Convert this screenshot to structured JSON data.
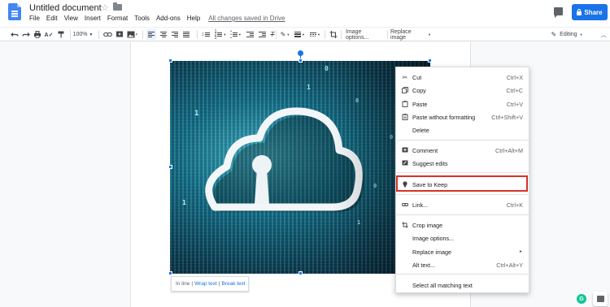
{
  "header": {
    "title": "Untitled document",
    "menus": [
      "File",
      "Edit",
      "View",
      "Insert",
      "Format",
      "Tools",
      "Add-ons",
      "Help"
    ],
    "save_status": "All changes saved in Drive",
    "share_label": "Share"
  },
  "toolbar": {
    "zoom": "100%",
    "image_options": "Image options...",
    "replace_image": "Replace image",
    "mode": "Editing"
  },
  "wrap_bar": {
    "inline": "In line",
    "wrap": "Wrap text",
    "break": "Break text",
    "separator": "|"
  },
  "context_menu": {
    "items": [
      {
        "label": "Cut",
        "shortcut": "Ctrl+X",
        "icon": "scissors-icon"
      },
      {
        "label": "Copy",
        "shortcut": "Ctrl+C",
        "icon": "copy-icon"
      },
      {
        "label": "Paste",
        "shortcut": "Ctrl+V",
        "icon": "paste-icon"
      },
      {
        "label": "Paste without formatting",
        "shortcut": "Ctrl+Shift+V",
        "icon": "paste-plain-icon"
      },
      {
        "label": "Delete",
        "shortcut": "",
        "icon": ""
      },
      {
        "label": "Comment",
        "shortcut": "Ctrl+Alt+M",
        "icon": "comment-icon"
      },
      {
        "label": "Suggest edits",
        "shortcut": "",
        "icon": "suggest-icon"
      },
      {
        "label": "Save to Keep",
        "shortcut": "",
        "icon": "lightbulb-icon"
      },
      {
        "label": "Link...",
        "shortcut": "Ctrl+K",
        "icon": "link-icon"
      },
      {
        "label": "Crop image",
        "shortcut": "",
        "icon": "crop-icon"
      },
      {
        "label": "Image options...",
        "shortcut": "",
        "icon": ""
      },
      {
        "label": "Replace image",
        "shortcut": "►",
        "icon": ""
      },
      {
        "label": "Alt text...",
        "shortcut": "Ctrl+Alt+Y",
        "icon": ""
      },
      {
        "label": "Select all matching text",
        "shortcut": "",
        "icon": ""
      }
    ]
  },
  "colors": {
    "accent": "#1a73e8",
    "highlight": "#d93025",
    "doc_icon": "#4285f4"
  },
  "image": {
    "binary_digits": [
      "0",
      "1",
      "0",
      "1",
      "0",
      "1",
      "1",
      "0"
    ]
  }
}
